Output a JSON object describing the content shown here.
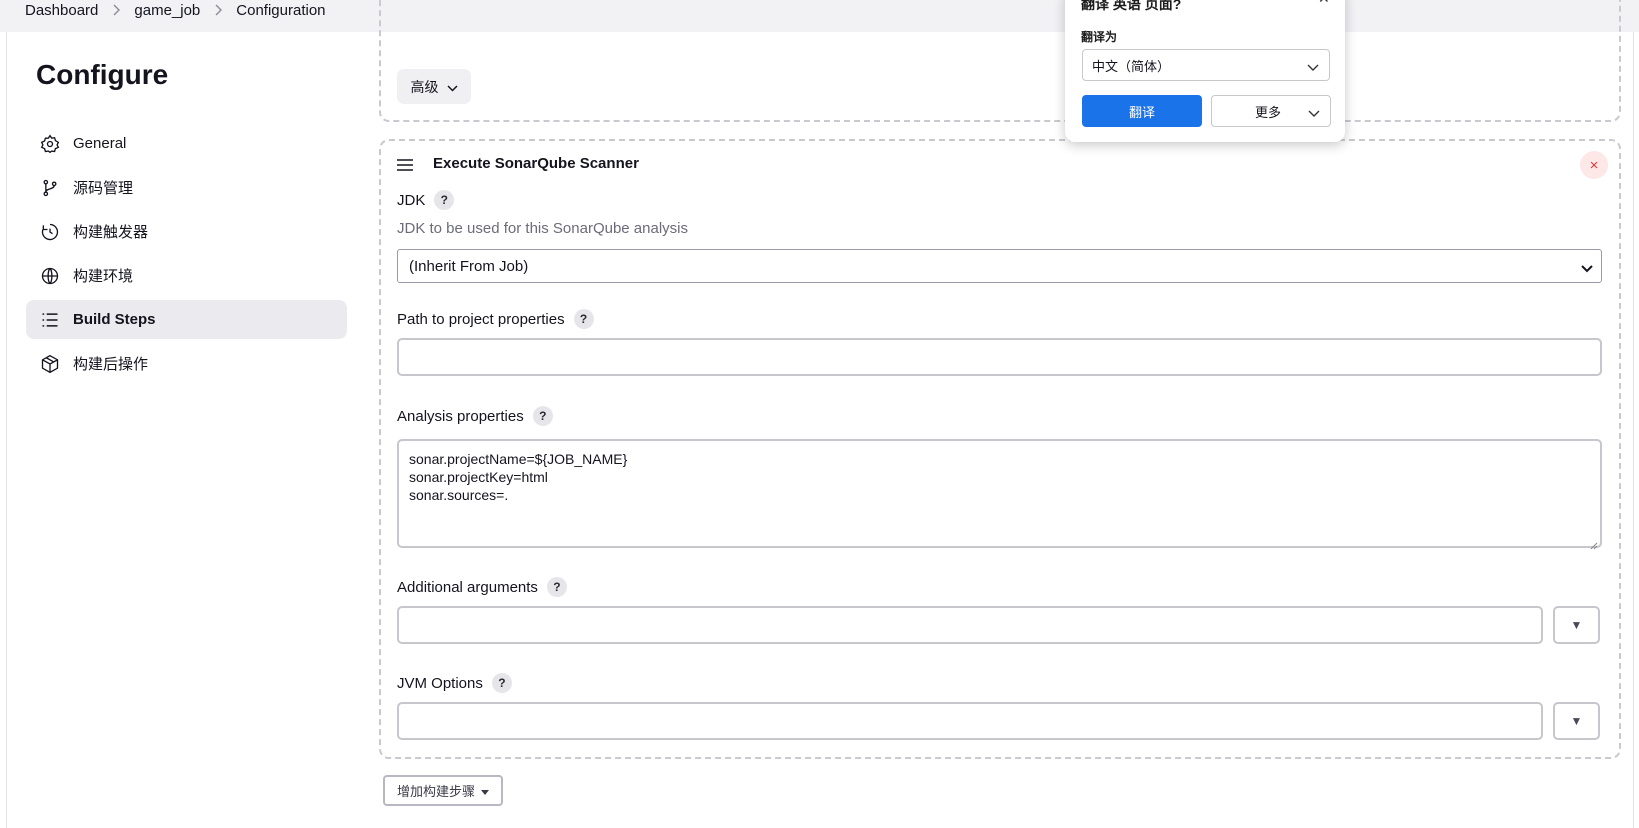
{
  "breadcrumb": [
    "Dashboard",
    "game_job",
    "Configuration"
  ],
  "sidebar": {
    "title": "Configure",
    "items": [
      {
        "label": "General",
        "icon": "gear-icon"
      },
      {
        "label": "源码管理",
        "icon": "branch-icon"
      },
      {
        "label": "构建触发器",
        "icon": "clock-icon"
      },
      {
        "label": "构建环境",
        "icon": "globe-icon"
      },
      {
        "label": "Build Steps",
        "icon": "list-icon",
        "active": true
      },
      {
        "label": "构建后操作",
        "icon": "package-icon"
      }
    ]
  },
  "advanced_button": "高级",
  "step": {
    "title": "Execute SonarQube Scanner",
    "close": "×",
    "jdk_label": "JDK",
    "jdk_desc": "JDK to be used for this SonarQube analysis",
    "jdk_value": "(Inherit From Job)",
    "path_label": "Path to project properties",
    "path_value": "",
    "analysis_label": "Analysis properties",
    "analysis_lines": [
      "sonar.projectName=${JOB_NAME}",
      "sonar.projectKey=html",
      "sonar.sources=."
    ],
    "args_label": "Additional arguments",
    "args_value": "",
    "jvm_label": "JVM Options",
    "jvm_value": "",
    "help": "?",
    "dropdown": "▼"
  },
  "add_step_button": "增加构建步骤",
  "translate_popup": {
    "title": "翻译 英语 页面?",
    "label": "翻译为",
    "language": "中文（简体）",
    "translate": "翻译",
    "more": "更多"
  },
  "colors": {
    "accent": "#1a73e8",
    "active_bg": "#ebebef",
    "danger": "#e0383e"
  }
}
